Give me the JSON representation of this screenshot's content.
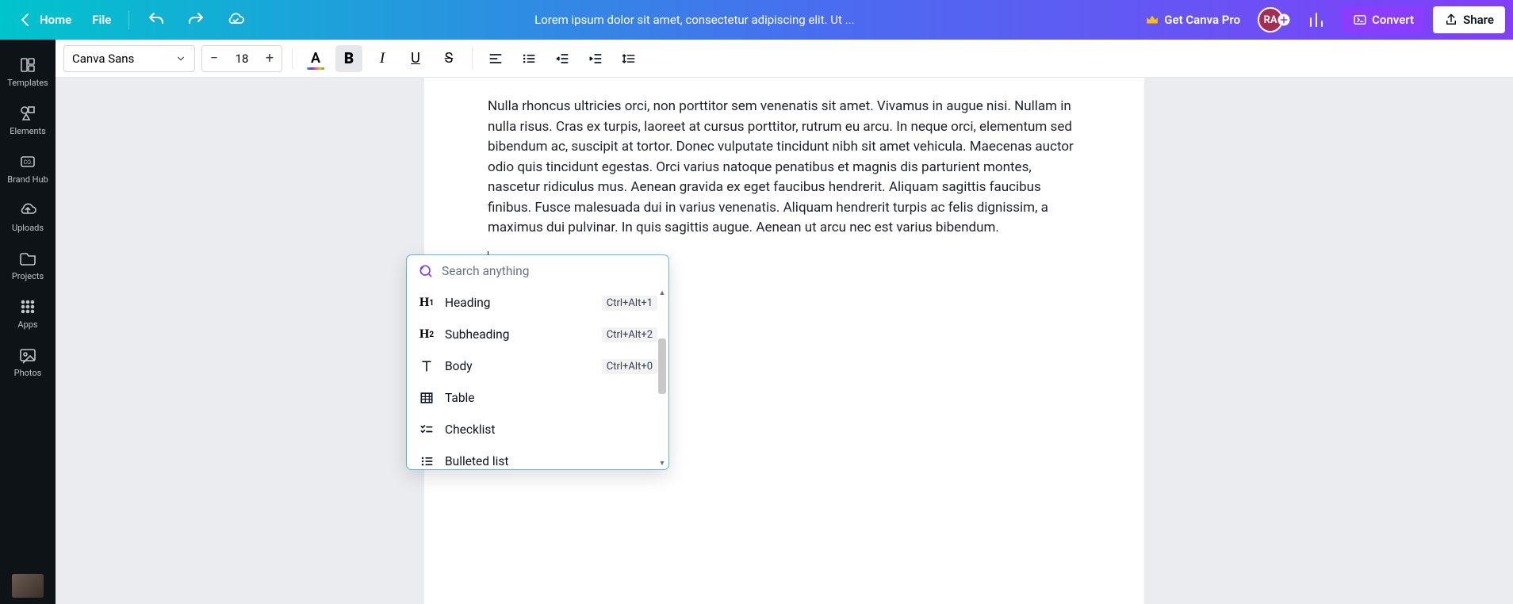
{
  "topbar": {
    "home": "Home",
    "file": "File",
    "title": "Lorem ipsum dolor sit amet, consectetur adipiscing elit. Ut ...",
    "pro": "Get Canva Pro",
    "avatar": "RA",
    "convert": "Convert",
    "share": "Share"
  },
  "sidebar": {
    "items": [
      {
        "label": "Templates"
      },
      {
        "label": "Elements"
      },
      {
        "label": "Brand Hub"
      },
      {
        "label": "Uploads"
      },
      {
        "label": "Projects"
      },
      {
        "label": "Apps"
      },
      {
        "label": "Photos"
      }
    ]
  },
  "toolbar": {
    "font": "Canva Sans",
    "size": "18",
    "minus": "−",
    "plus": "+"
  },
  "document": {
    "body": "Nulla rhoncus ultricies orci, non porttitor sem venenatis sit amet. Vivamus in augue nisi. Nullam in nulla risus. Cras ex turpis, laoreet at cursus porttitor, rutrum eu arcu. In neque orci, elementum sed bibendum ac, suscipit at tortor. Donec vulputate tincidunt nibh sit amet vehicula. Maecenas auctor odio quis tincidunt egestas. Orci varius natoque penatibus et magnis dis parturient montes, nascetur ridiculus mus. Aenean gravida ex eget faucibus hendrerit. Aliquam sagittis faucibus finibus. Fusce malesuada dui in varius venenatis. Aliquam hendrerit turpis ac felis dignissim, a maximus dui pulvinar. In quis sagittis augue. Aenean ut arcu nec est varius bibendum."
  },
  "popup": {
    "search_placeholder": "Search anything",
    "items": [
      {
        "label": "Heading",
        "shortcut": "Ctrl+Alt+1"
      },
      {
        "label": "Subheading",
        "shortcut": "Ctrl+Alt+2"
      },
      {
        "label": "Body",
        "shortcut": "Ctrl+Alt+0"
      },
      {
        "label": "Table",
        "shortcut": ""
      },
      {
        "label": "Checklist",
        "shortcut": ""
      },
      {
        "label": "Bulleted list",
        "shortcut": ""
      }
    ]
  }
}
